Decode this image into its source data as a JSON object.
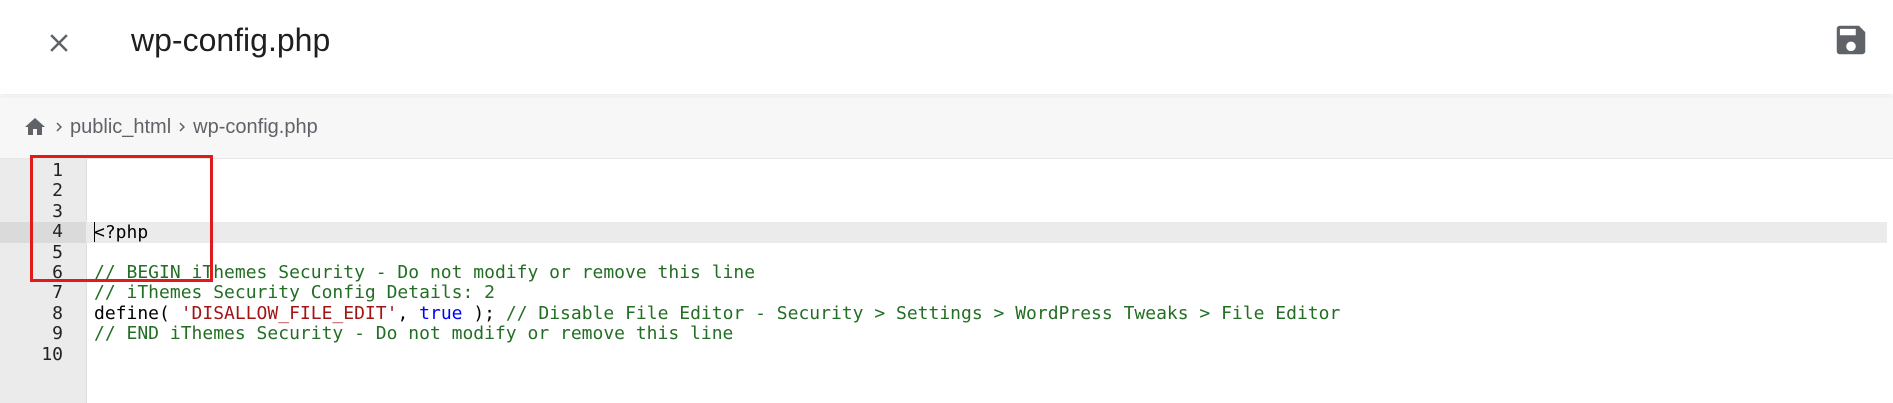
{
  "header": {
    "title": "wp-config.php",
    "close_icon": "close-icon",
    "save_icon": "save-icon"
  },
  "breadcrumb": {
    "home_icon": "home-icon",
    "items": [
      {
        "label": "public_html"
      },
      {
        "label": "wp-config.php"
      }
    ]
  },
  "editor": {
    "active_line": 4,
    "lines": [
      {
        "num": "1",
        "text": ""
      },
      {
        "num": "2",
        "text": ""
      },
      {
        "num": "3",
        "text": ""
      },
      {
        "num": "4",
        "text": "<?php"
      },
      {
        "num": "5",
        "text": ""
      },
      {
        "num": "6",
        "text": "// BEGIN iThemes Security - Do not modify or remove this line"
      },
      {
        "num": "7",
        "text": "// iThemes Security Config Details: 2"
      },
      {
        "num": "8",
        "parts": [
          {
            "text": "define( ",
            "style": "fn"
          },
          {
            "text": "'DISALLOW_FILE_EDIT'",
            "style": "str"
          },
          {
            "text": ", ",
            "style": "fn"
          },
          {
            "text": "true",
            "style": "kw"
          },
          {
            "text": " ); ",
            "style": "fn"
          },
          {
            "text": "// Disable File Editor - Security > Settings > WordPress Tweaks > File Editor",
            "style": "cmt"
          }
        ]
      },
      {
        "num": "9",
        "text": "// END iThemes Security - Do not modify or remove this line"
      },
      {
        "num": "10",
        "text": ""
      }
    ]
  },
  "colors": {
    "highlight_box": "#e01b1b",
    "comment": "#236e24",
    "string": "#a31515",
    "keyword": "#0000ff"
  }
}
